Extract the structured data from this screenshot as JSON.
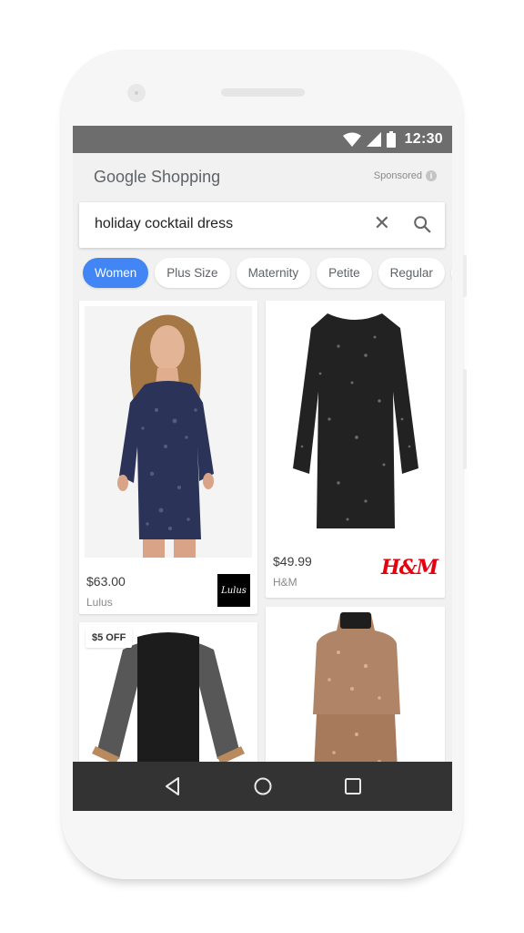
{
  "status_bar": {
    "time": "12:30",
    "icons": [
      "wifi-icon",
      "signal-icon",
      "battery-icon"
    ]
  },
  "header": {
    "brand": "Google Shopping",
    "sponsored_label": "Sponsored",
    "info_icon_glyph": "i"
  },
  "search": {
    "query": "holiday cocktail dress",
    "clear_glyph": "✕"
  },
  "chips": [
    {
      "label": "Women",
      "active": true
    },
    {
      "label": "Plus Size",
      "active": false
    },
    {
      "label": "Maternity",
      "active": false
    },
    {
      "label": "Petite",
      "active": false
    },
    {
      "label": "Regular",
      "active": false
    }
  ],
  "products": [
    {
      "price": "$63.00",
      "merchant": "Lulus",
      "logo_text": "Lulus",
      "description": "navy sequin long-sleeve mini dress on model"
    },
    {
      "price": "$49.99",
      "merchant": "H&M",
      "logo_text": "H&M",
      "description": "black sequin long-sleeve dress"
    },
    {
      "badge": "$5 OFF",
      "description": "black dress with sheer bell sleeves and sequin cuffs"
    },
    {
      "description": "rose gold sequin sleeveless high-neck dress"
    }
  ],
  "colors": {
    "accent": "#4285f4",
    "status_bar": "#6d6d6d",
    "nav_bar": "#333333",
    "hm_red": "#e50010"
  }
}
